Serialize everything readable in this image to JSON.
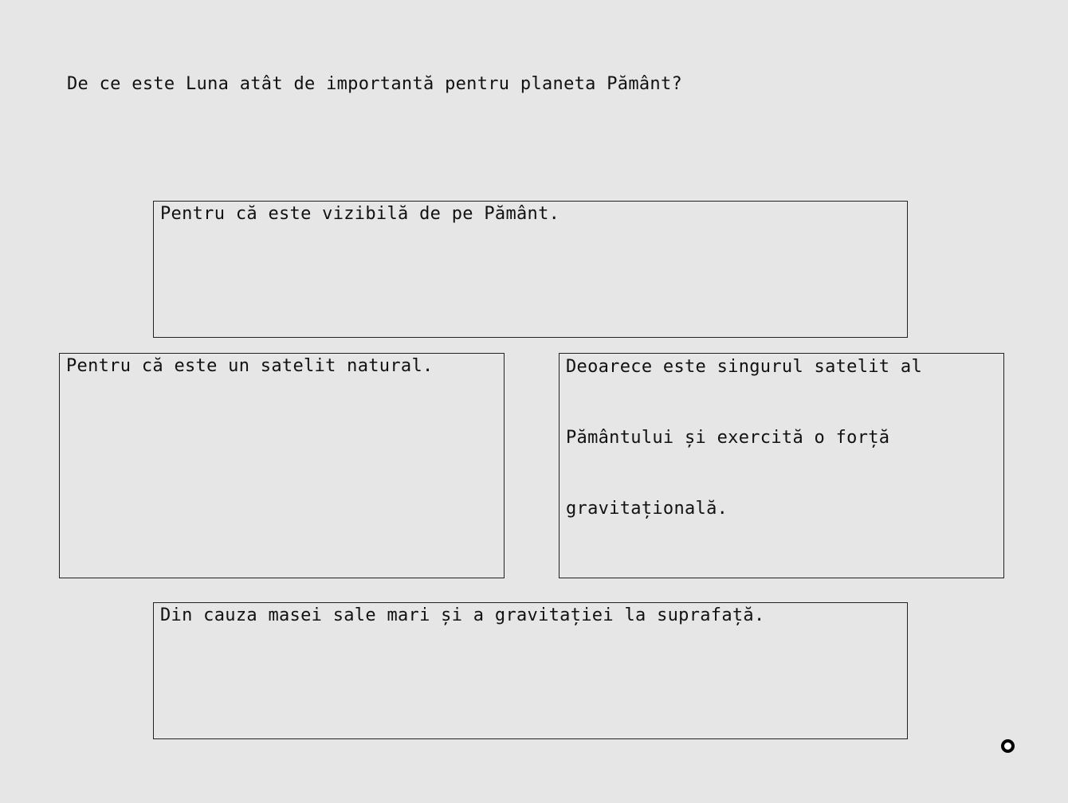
{
  "question": "De ce este Luna atât de importantă pentru planeta Pământ?",
  "options": [
    {
      "text": "Pentru că este vizibilă de pe Pământ."
    },
    {
      "text": "Pentru că este un satelit natural."
    },
    {
      "text": "Deoarece este singurul satelit al\nPământului și exercită o forță\ngravitațională."
    },
    {
      "text": "Din cauza masei sale mari și a gravitației la suprafață."
    }
  ],
  "cursor": {
    "icon": "circle-cursor-icon"
  }
}
